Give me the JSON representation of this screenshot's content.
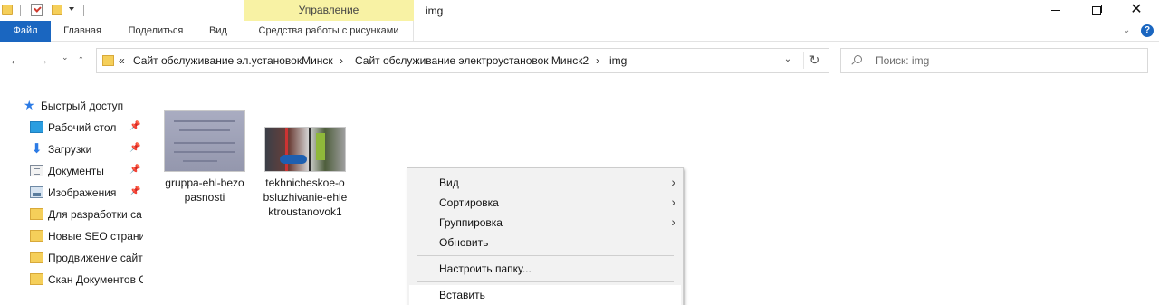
{
  "window": {
    "title": "img",
    "manage_tab": "Управление",
    "close_glyph": "✕"
  },
  "ribbon": {
    "tabs": [
      "Файл",
      "Главная",
      "Поделиться",
      "Вид",
      "Средства работы с рисунками"
    ],
    "collapse_glyph": "⌄",
    "help_glyph": "?"
  },
  "nav": {
    "back_glyph": "←",
    "forward_glyph": "→",
    "recent_glyph": "⌄",
    "up_glyph": "↑"
  },
  "address": {
    "overflow": "«",
    "segments": [
      "Сайт обслуживание эл.установокМинск",
      "Сайт обслуживание электроустановок Минск2",
      "img"
    ],
    "separator": "›",
    "dropdown_glyph": "⌄",
    "refresh_glyph": "↻"
  },
  "search": {
    "placeholder": "Поиск: img"
  },
  "sidebar": {
    "quick_access": "Быстрый доступ",
    "items": [
      {
        "label": "Рабочий стол",
        "icon": "desktop-icon",
        "pinned": true
      },
      {
        "label": "Загрузки",
        "icon": "downloads-icon",
        "pinned": true
      },
      {
        "label": "Документы",
        "icon": "documents-icon",
        "pinned": true
      },
      {
        "label": "Изображения",
        "icon": "pictures-icon",
        "pinned": true
      },
      {
        "label": "Для разработки са",
        "icon": "folder-icon",
        "pinned": false
      },
      {
        "label": "Новые SEO страни",
        "icon": "folder-icon",
        "pinned": false
      },
      {
        "label": "Продвижение сайт",
        "icon": "folder-icon",
        "pinned": false
      },
      {
        "label": "Скан Документов С",
        "icon": "folder-icon",
        "pinned": false
      }
    ],
    "pin_glyph": "📌"
  },
  "files": [
    {
      "name_line1": "gruppa-ehl-bezo",
      "name_line2": "pasnosti",
      "name_line3": ""
    },
    {
      "name_line1": "tekhnicheskoe-o",
      "name_line2": "bsluzhivanie-ehle",
      "name_line3": "ktroustanovok1"
    }
  ],
  "context_menu": {
    "items": [
      {
        "label": "Вид",
        "submenu": true
      },
      {
        "label": "Сортировка",
        "submenu": true
      },
      {
        "label": "Группировка",
        "submenu": true
      },
      {
        "label": "Обновить",
        "submenu": false
      },
      {
        "label": "Настроить папку...",
        "submenu": false
      },
      {
        "label": "Вставить",
        "submenu": false
      }
    ],
    "submenu_glyph": "›"
  },
  "colors": {
    "file_tab": "#1a66c0",
    "manage_tab": "#f8f2a4",
    "folder": "#f5cf5a"
  }
}
